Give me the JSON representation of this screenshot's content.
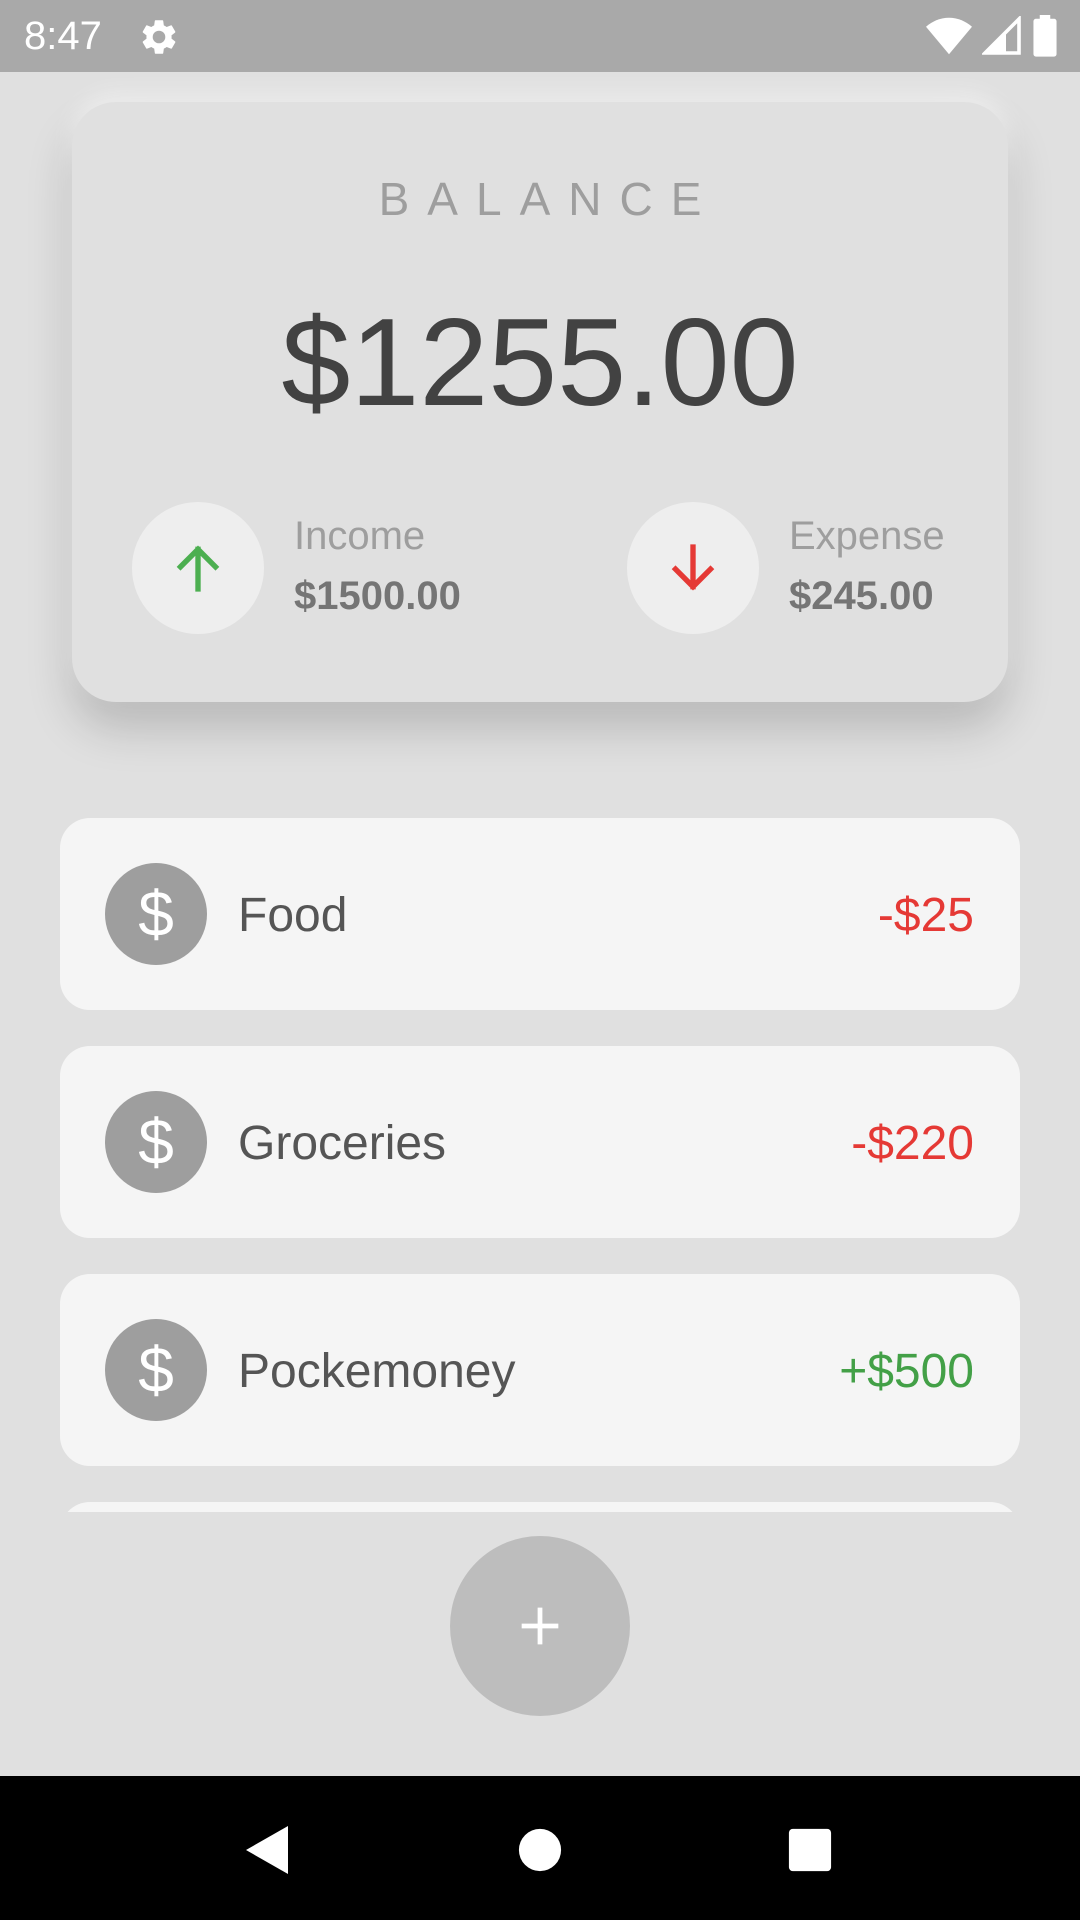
{
  "status_bar": {
    "time": "8:47"
  },
  "balance_card": {
    "label": "BALANCE",
    "amount": "$1255.00",
    "income": {
      "label": "Income",
      "value": "$1500.00",
      "color": "#4caf50"
    },
    "expense": {
      "label": "Expense",
      "value": "$245.00",
      "color": "#e53935"
    }
  },
  "transactions": [
    {
      "icon": "$",
      "name": "Food",
      "amount": "-$25",
      "type": "expense"
    },
    {
      "icon": "$",
      "name": "Groceries",
      "amount": "-$220",
      "type": "expense"
    },
    {
      "icon": "$",
      "name": "Pockemoney",
      "amount": "+$500",
      "type": "income"
    }
  ],
  "fab": {
    "icon": "plus-icon"
  },
  "nav_bar": {
    "icons": [
      "back-icon",
      "home-icon",
      "recents-icon"
    ]
  }
}
